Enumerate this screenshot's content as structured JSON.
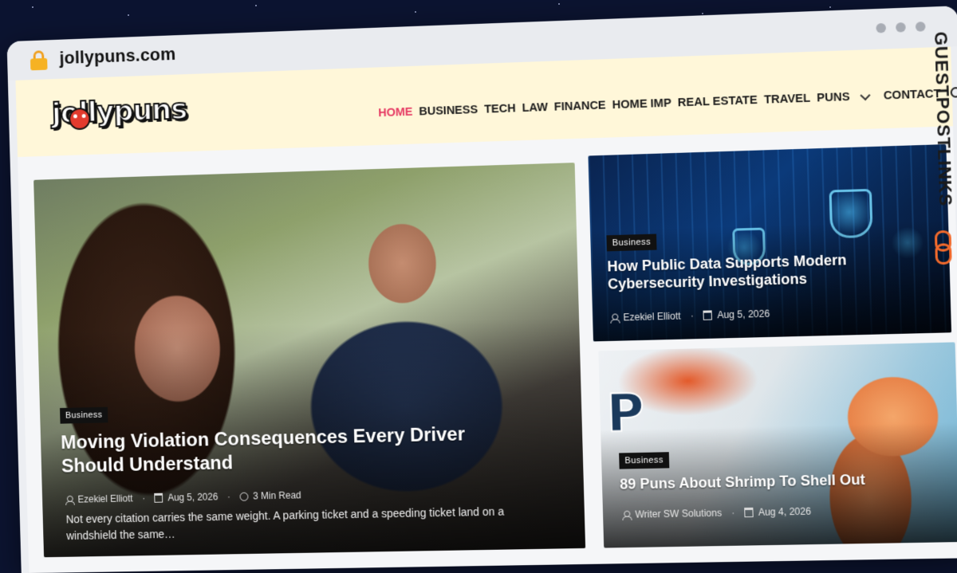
{
  "browser": {
    "url": "jollypuns.com"
  },
  "site": {
    "logo_text": "jollypuns",
    "side_brand": "GUESTPOSTLINKS"
  },
  "nav": {
    "items": [
      {
        "label": "HOME",
        "active": true
      },
      {
        "label": "BUSINESS",
        "active": false
      },
      {
        "label": "TECH",
        "active": false
      },
      {
        "label": "LAW",
        "active": false
      },
      {
        "label": "FINANCE",
        "active": false
      },
      {
        "label": "HOME IMP",
        "active": false
      },
      {
        "label": "REAL ESTATE",
        "active": false
      },
      {
        "label": "TRAVEL",
        "active": false
      },
      {
        "label": "PUNS",
        "active": false
      },
      {
        "label": "CONTACT",
        "active": false
      }
    ]
  },
  "featured": {
    "category": "Business",
    "title": "Moving Violation Consequences Every Driver Should Understand",
    "author": "Ezekiel Elliott",
    "date": "Aug 5, 2026",
    "read_time": "3 Min Read",
    "excerpt": "Not every citation carries the same weight. A parking ticket and a speeding ticket land on a windshield the same…"
  },
  "side_posts": [
    {
      "category": "Business",
      "title": "How Public Data Supports Modern Cybersecurity Investigations",
      "author": "Ezekiel Elliott",
      "date": "Aug 5, 2026"
    },
    {
      "category": "Business",
      "title": "89 Puns About Shrimp To Shell Out",
      "author": "Writer SW Solutions",
      "date": "Aug 4, 2026"
    }
  ],
  "colors": {
    "accent": "#e63a63",
    "header_bg": "#fff7d9",
    "brand_orange": "#f26a2c"
  }
}
